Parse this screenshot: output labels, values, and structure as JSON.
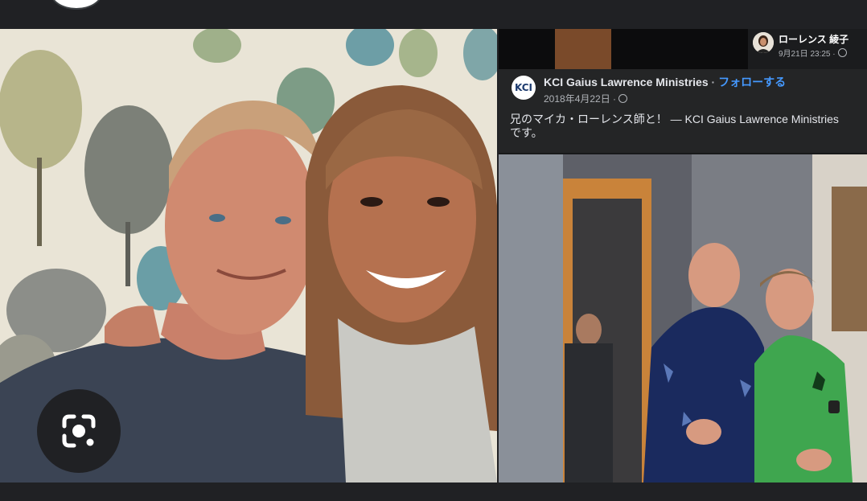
{
  "viewer": {
    "lens_icon": "google-lens-icon"
  },
  "shared_post": {
    "sharer": {
      "name": "ローレンス 綾子",
      "date": "9月21日 23:25 ·"
    },
    "page_name": "KCI Gaius Lawrence Ministries",
    "separator": " · ",
    "follow_label": "フォローする",
    "date": "2018年4月22日 ·",
    "text_line1": "兄のマイカ・ローレンス師と！ — KCI Gaius Lawrence Ministries",
    "text_line2": "です。",
    "logo_text": "KCI"
  },
  "colors": {
    "background": "#202124",
    "follow_link": "#4599ff",
    "shirt_green": "#3fa64f",
    "shirt_navy": "#1a2a5e"
  }
}
